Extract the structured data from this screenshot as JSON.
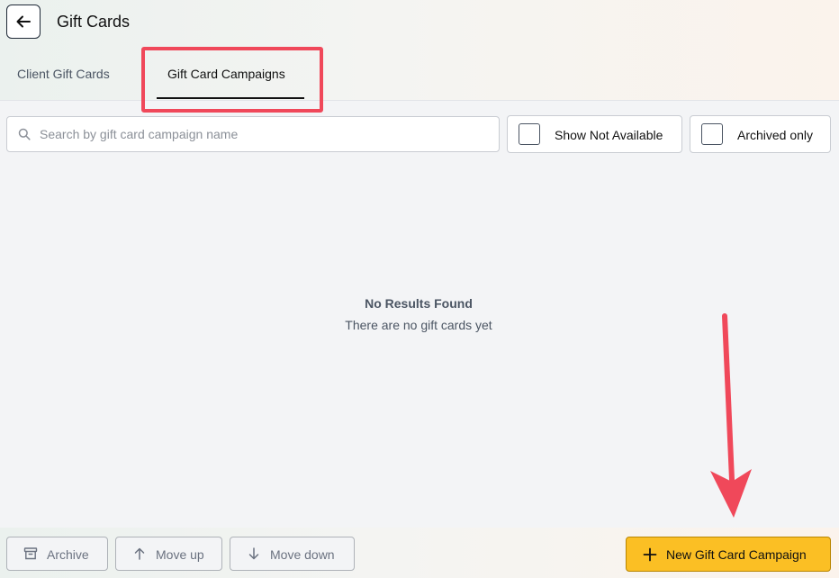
{
  "header": {
    "title": "Gift Cards"
  },
  "tabs": [
    {
      "label": "Client Gift Cards",
      "active": false
    },
    {
      "label": "Gift Card Campaigns",
      "active": true
    }
  ],
  "filters": {
    "search_placeholder": "Search by gift card campaign name",
    "search_value": "",
    "show_not_available_label": "Show Not Available",
    "show_not_available_checked": false,
    "archived_only_label": "Archived only",
    "archived_only_checked": false
  },
  "empty_state": {
    "title": "No Results Found",
    "message": "There are no gift cards yet"
  },
  "footer": {
    "archive_label": "Archive",
    "move_up_label": "Move up",
    "move_down_label": "Move down",
    "new_campaign_label": "New Gift Card Campaign"
  },
  "icons": {
    "back": "arrow-left-icon",
    "search": "search-icon",
    "archive": "archive-box-icon",
    "move_up": "arrow-up-icon",
    "move_down": "arrow-down-icon",
    "add": "plus-icon"
  },
  "colors": {
    "accent_button": "#fbbf24",
    "annotation": "#f0485a",
    "tab_active_underline": "#111111"
  }
}
